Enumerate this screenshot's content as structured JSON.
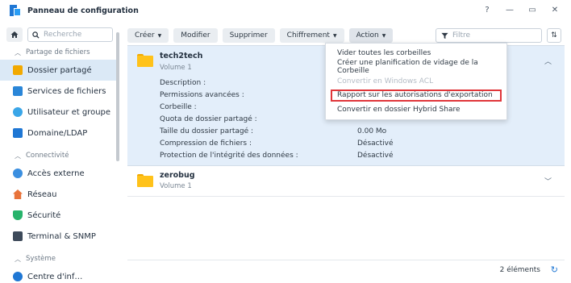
{
  "window": {
    "title": "Panneau de configuration",
    "controls": [
      "?",
      "—",
      "▭",
      "✕"
    ]
  },
  "sidebar": {
    "search_placeholder": "Recherche",
    "sections": [
      {
        "label": "Partage de fichiers",
        "items": [
          {
            "label": "Dossier partagé",
            "icon": "shared-folder-icon",
            "active": true
          },
          {
            "label": "Services de fichiers",
            "icon": "file-services-icon"
          },
          {
            "label": "Utilisateur et groupe",
            "icon": "users-icon"
          },
          {
            "label": "Domaine/LDAP",
            "icon": "domain-icon"
          }
        ]
      },
      {
        "label": "Connectivité",
        "items": [
          {
            "label": "Accès externe",
            "icon": "external-access-icon"
          },
          {
            "label": "Réseau",
            "icon": "network-icon"
          },
          {
            "label": "Sécurité",
            "icon": "security-icon"
          },
          {
            "label": "Terminal & SNMP",
            "icon": "terminal-icon"
          }
        ]
      },
      {
        "label": "Système",
        "items": [
          {
            "label": "Centre d'inf…",
            "icon": "info-center-icon"
          }
        ]
      }
    ]
  },
  "toolbar": {
    "create": "Créer",
    "edit": "Modifier",
    "delete": "Supprimer",
    "encryption": "Chiffrement",
    "action": "Action",
    "filter_placeholder": "Filtre"
  },
  "action_menu": [
    {
      "label": "Vider toutes les corbeilles",
      "state": "normal"
    },
    {
      "label": "Créer une planification de vidage de la Corbeille",
      "state": "normal"
    },
    {
      "label": "Convertir en Windows ACL",
      "state": "disabled"
    },
    {
      "label": "Rapport sur les autorisations d'exportation",
      "state": "highlighted"
    },
    {
      "label": "Convertir en dossier Hybrid Share",
      "state": "normal"
    }
  ],
  "shares": [
    {
      "name": "tech2tech",
      "volume": "Volume 1",
      "expanded": true,
      "properties": [
        {
          "label": "Description :",
          "value": ""
        },
        {
          "label": "Permissions avancées :",
          "value": ""
        },
        {
          "label": "Corbeille :",
          "value": ""
        },
        {
          "label": "Quota de dossier partagé :",
          "value": ""
        },
        {
          "label": "Taille du dossier partagé :",
          "value": "0.00 Mo"
        },
        {
          "label": "Compression de fichiers :",
          "value": "Désactivé"
        },
        {
          "label": "Protection de l'intégrité des données :",
          "value": "Désactivé"
        }
      ]
    },
    {
      "name": "zerobug",
      "volume": "Volume 1",
      "expanded": false
    }
  ],
  "status": {
    "count": "2 éléments"
  },
  "colors": {
    "accent": "#1f77d4",
    "selected_row": "#e3eefa",
    "highlight_border": "#e0363a",
    "folder": "#ffc21a"
  }
}
